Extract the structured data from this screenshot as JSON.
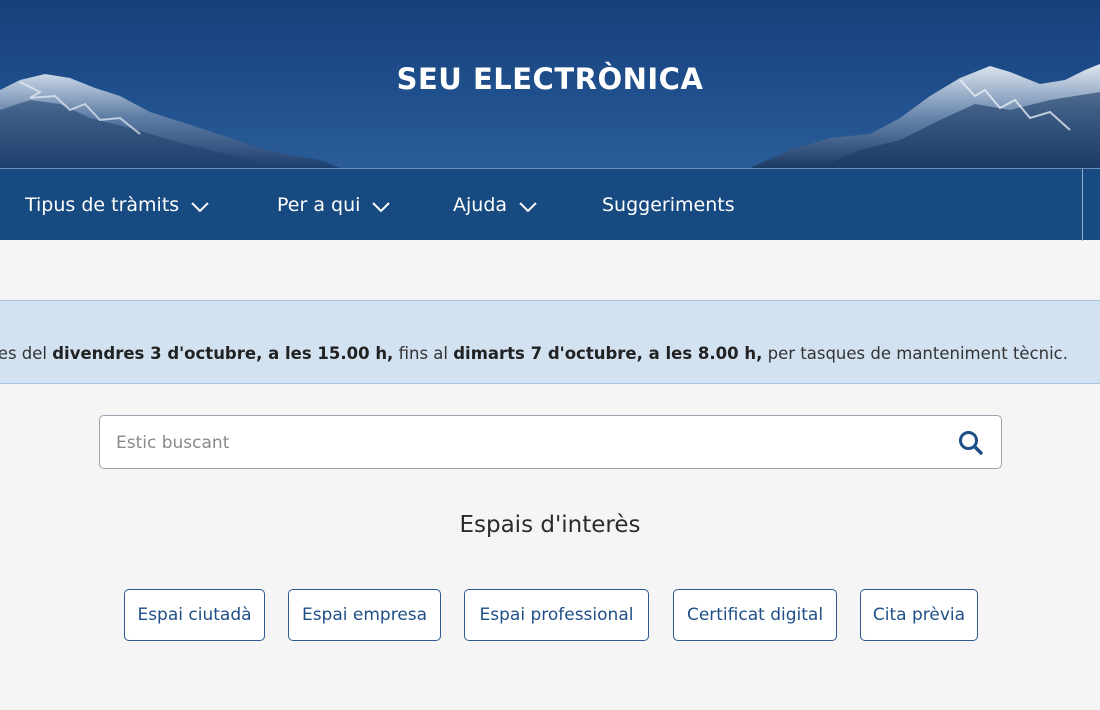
{
  "header": {
    "title": "SEU ELECTRÒNICA"
  },
  "nav": {
    "items": [
      {
        "label": "Tipus de tràmits",
        "has_dropdown": true,
        "icon": "chevron-down-icon"
      },
      {
        "label": "Per a qui",
        "has_dropdown": true,
        "icon": "chevron-down-icon"
      },
      {
        "label": "Ajuda",
        "has_dropdown": true,
        "icon": "chevron-down-icon"
      },
      {
        "label": "Suggeriments",
        "has_dropdown": false
      }
    ]
  },
  "notice": {
    "segments": [
      {
        "text": "ble des del ",
        "bold": false
      },
      {
        "text": "divendres 3 d'octubre, a les 15.00 h,",
        "bold": true
      },
      {
        "text": " fins al ",
        "bold": false
      },
      {
        "text": "dimarts 7 d'octubre, a les 8.00 h,",
        "bold": true
      },
      {
        "text": " per tasques de manteniment tècnic.",
        "bold": false
      }
    ]
  },
  "search": {
    "placeholder": "Estic buscant",
    "value": "",
    "icon": "search-icon"
  },
  "interest": {
    "heading": "Espais d'interès",
    "buttons": [
      {
        "label": "Espai ciutadà"
      },
      {
        "label": "Espai empresa"
      },
      {
        "label": "Espai professional"
      },
      {
        "label": "Certificat digital"
      },
      {
        "label": "Cita prèvia"
      }
    ]
  },
  "colors": {
    "hero": "#1f4f8c",
    "navbar": "#174a80",
    "notice_bg": "#d3e2f1",
    "accent": "#1f4f86",
    "page_bg": "#f5f5f5"
  }
}
